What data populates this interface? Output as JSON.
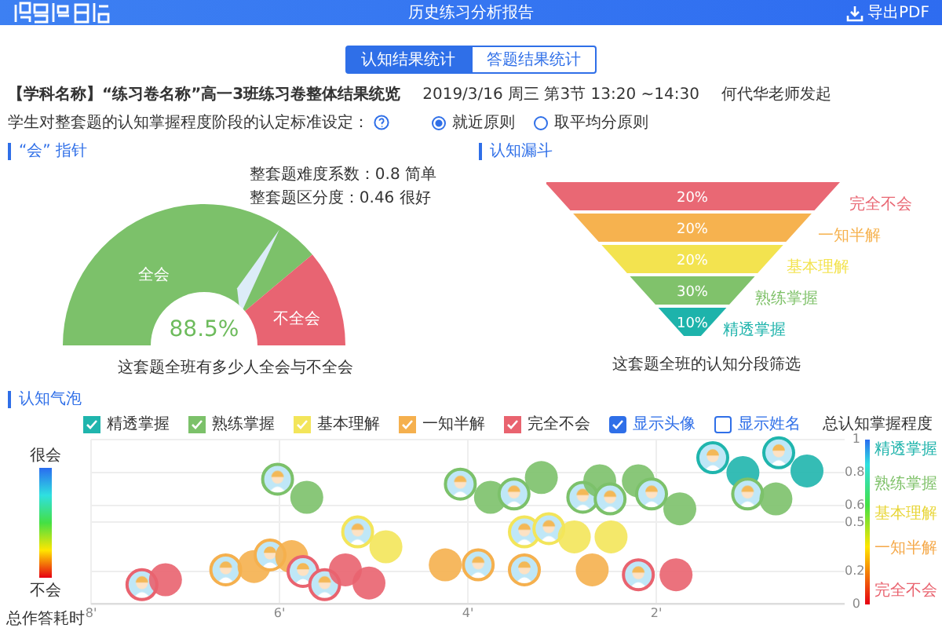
{
  "header": {
    "title": "历史练习分析报告",
    "export_label": "导出PDF"
  },
  "tabs": [
    {
      "label": "认知结果统计",
      "selected": true
    },
    {
      "label": "答题结果统计",
      "selected": false
    }
  ],
  "summary": {
    "title": "【学科名称】“练习卷名称”高一3班练习卷整体结果统览",
    "date": "2019/3/16 周三 第3节  13:20 ~14:30",
    "teacher": "何代华老师发起"
  },
  "criteria": {
    "label": "学生对整套题的认知掌握程度阶段的认定标准设定：",
    "options": [
      {
        "label": "就近原则",
        "selected": true
      },
      {
        "label": "取平均分原则",
        "selected": false
      }
    ]
  },
  "gauge": {
    "heading": "“会” 指针",
    "stats": [
      "整套题难度系数：0.8  简单",
      "整套题区分度：0.46  很好"
    ],
    "whole_label": "全会",
    "partial_label": "不全会",
    "value": "88.5%",
    "caption": "这套题全班有多少人全会与不全会"
  },
  "funnel": {
    "heading": "认知漏斗",
    "levels": [
      {
        "percent": "20%",
        "label": "完全不会",
        "color": "#e96874"
      },
      {
        "percent": "20%",
        "label": "一知半解",
        "color": "#f6b24f"
      },
      {
        "percent": "20%",
        "label": "基本理解",
        "color": "#f3e34f"
      },
      {
        "percent": "30%",
        "label": "熟练掌握",
        "color": "#80c26b"
      },
      {
        "percent": "10%",
        "label": "精透掌握",
        "color": "#1db3ab"
      }
    ],
    "caption": "这套题全班的认知分段筛选"
  },
  "bubbles": {
    "heading": "认知气泡",
    "toggles": [
      {
        "label": "显示头像",
        "checked": true
      },
      {
        "label": "显示姓名",
        "checked": false
      }
    ],
    "scale_title": "总认知掌握程度",
    "left_top": "很会",
    "left_bottom": "不会",
    "time_label": "总作答耗时",
    "levels": [
      {
        "label": "精透掌握",
        "color": "#1db3ab"
      },
      {
        "label": "熟练掌握",
        "color": "#80c26b"
      },
      {
        "label": "基本理解",
        "color": "#e8d63a"
      },
      {
        "label": "一知半解",
        "color": "#f5a94a"
      },
      {
        "label": "完全不会",
        "color": "#e9636f"
      }
    ],
    "groups": [
      {
        "checked": true,
        "with_avatar": [
          true,
          false,
          true,
          false
        ]
      },
      {
        "checked": true,
        "with_avatar": [
          true,
          false,
          true,
          false,
          true,
          false,
          true,
          false,
          true,
          false,
          true,
          false,
          true,
          false
        ]
      },
      {
        "checked": true,
        "with_avatar": [
          true,
          false,
          true,
          true,
          false,
          false
        ]
      },
      {
        "checked": true,
        "with_avatar": [
          true,
          false,
          true,
          false,
          false,
          true,
          true,
          false
        ]
      },
      {
        "checked": true,
        "with_avatar": [
          true,
          false,
          true,
          true,
          false,
          false,
          true,
          false
        ]
      }
    ],
    "chart_data": {
      "type": "scatter",
      "grid": true,
      "xlim": [
        8,
        0
      ],
      "ylim": [
        0,
        1
      ],
      "xticks": [
        {
          "value": 8,
          "label": "8'"
        },
        {
          "value": 6,
          "label": "6'"
        },
        {
          "value": 4,
          "label": "4'"
        },
        {
          "value": 2,
          "label": "2'"
        }
      ],
      "yticks": [
        0,
        0.2,
        0.5,
        0.6,
        0.8,
        1
      ],
      "series": [
        {
          "name": "精透掌握",
          "color": "#1fb5ad",
          "x": [
            1.4,
            1.08,
            0.7,
            0.4
          ],
          "values": [
            0.89,
            0.8,
            0.92,
            0.81
          ]
        },
        {
          "name": "熟练掌握",
          "color": "#7cc16a",
          "x": [
            6.02,
            5.71,
            4.08,
            3.76,
            3.51,
            3.22,
            2.78,
            2.6,
            2.49,
            2.19,
            2.05,
            1.75,
            1.03,
            0.73
          ],
          "values": [
            0.76,
            0.65,
            0.73,
            0.65,
            0.67,
            0.77,
            0.65,
            0.75,
            0.64,
            0.75,
            0.67,
            0.58,
            0.67,
            0.64
          ]
        },
        {
          "name": "基本理解",
          "color": "#f3e55a",
          "x": [
            5.17,
            4.87,
            3.4,
            3.14,
            2.87,
            2.48
          ],
          "values": [
            0.44,
            0.35,
            0.44,
            0.46,
            0.41,
            0.41
          ]
        },
        {
          "name": "一知半解",
          "color": "#f5b04e",
          "x": [
            6.57,
            6.27,
            6.1,
            5.87,
            4.24,
            3.89,
            3.4,
            2.68
          ],
          "values": [
            0.21,
            0.23,
            0.3,
            0.29,
            0.24,
            0.24,
            0.21,
            0.21
          ]
        },
        {
          "name": "完全不会",
          "color": "#e9636f",
          "x": [
            7.46,
            7.21,
            5.75,
            5.52,
            5.3,
            5.05,
            2.19,
            1.79
          ],
          "values": [
            0.12,
            0.15,
            0.2,
            0.12,
            0.21,
            0.13,
            0.18,
            0.18
          ]
        }
      ]
    }
  }
}
